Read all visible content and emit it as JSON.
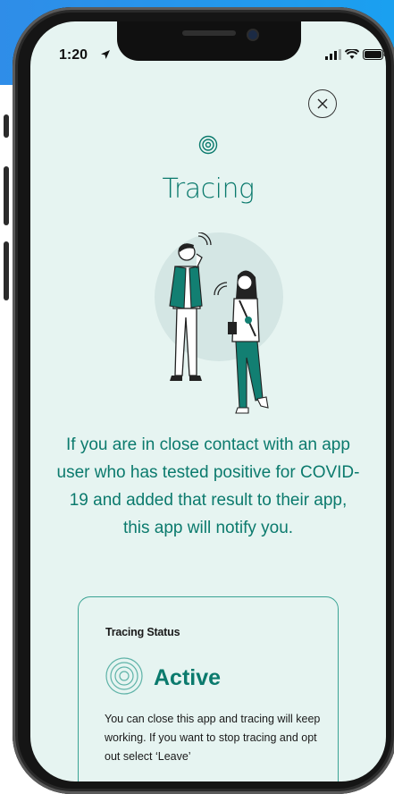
{
  "status_bar": {
    "time": "1:20"
  },
  "screen": {
    "title": "Tracing",
    "description": "If you are in close contact with an app user who has tested positive for COVID-19 and added that result to their app, this app will notify you."
  },
  "status_card": {
    "label": "Tracing Status",
    "state": "Active",
    "body": "You can close this app and tracing will keep working. If you want to stop tracing and opt out select ‘Leave’"
  },
  "colors": {
    "accent": "#0b7a6d",
    "background": "#e6f4f1",
    "card_border": "#3aa394",
    "top_accent": "#2f8de8"
  },
  "icons": [
    "location-arrow-icon",
    "signal-icon",
    "wifi-icon",
    "battery-icon",
    "close-icon",
    "tracing-rings-icon",
    "active-rings-icon"
  ]
}
